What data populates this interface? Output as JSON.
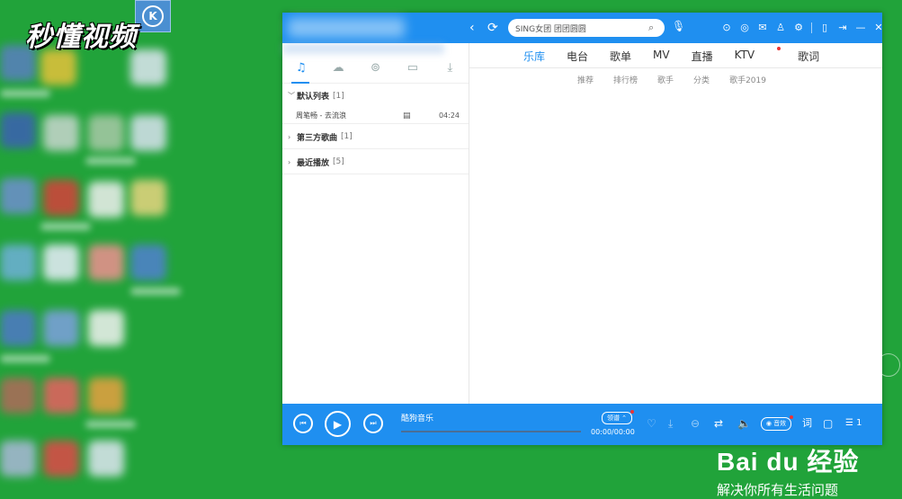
{
  "desktop": {
    "watermark_top": "秒懂视频"
  },
  "window": {
    "search": {
      "query": "SING女团 团团圆圆"
    },
    "left_panel": {
      "tabs": [
        {
          "icon": "music-note-icon"
        },
        {
          "icon": "cloud-icon"
        },
        {
          "icon": "radio-icon"
        },
        {
          "icon": "phone-icon"
        },
        {
          "icon": "download-icon"
        }
      ],
      "groups": [
        {
          "name": "默认列表",
          "count": "[1]"
        },
        {
          "name": "第三方歌曲",
          "count": "[1]"
        },
        {
          "name": "最近播放",
          "count": "[5]"
        }
      ],
      "songs": [
        {
          "title": "周笔畅 - 去流浪",
          "duration": "04:24"
        }
      ]
    },
    "nav": [
      "乐库",
      "电台",
      "歌单",
      "MV",
      "直播",
      "KTV",
      "歌词"
    ],
    "subnav": [
      "推荐",
      "排行榜",
      "歌手",
      "分类",
      "歌手2019"
    ],
    "player": {
      "song_name": "酷狗音乐",
      "quality": "领谱",
      "time": "00:00/00:00",
      "effect": "音效",
      "lyrics": "词",
      "queue_count": "1"
    }
  },
  "baidu": {
    "logo": "Bai du 经验",
    "slogan": "解决你所有生活问题"
  }
}
